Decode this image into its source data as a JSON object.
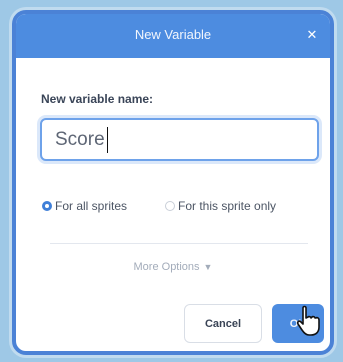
{
  "dialog": {
    "title": "New Variable",
    "close_icon": "close-icon",
    "name_label": "New variable name:",
    "name_value": "Score",
    "scope_options": [
      {
        "label": "For all sprites",
        "selected": true
      },
      {
        "label": "For this sprite only",
        "selected": false
      }
    ],
    "more_options_label": "More Options",
    "more_options_icon": "chevron-down-icon",
    "cancel_label": "Cancel",
    "ok_label": "OK"
  },
  "colors": {
    "header": "#4d8ce0",
    "border": "#4b82d6",
    "background": "#9ec8e6"
  }
}
